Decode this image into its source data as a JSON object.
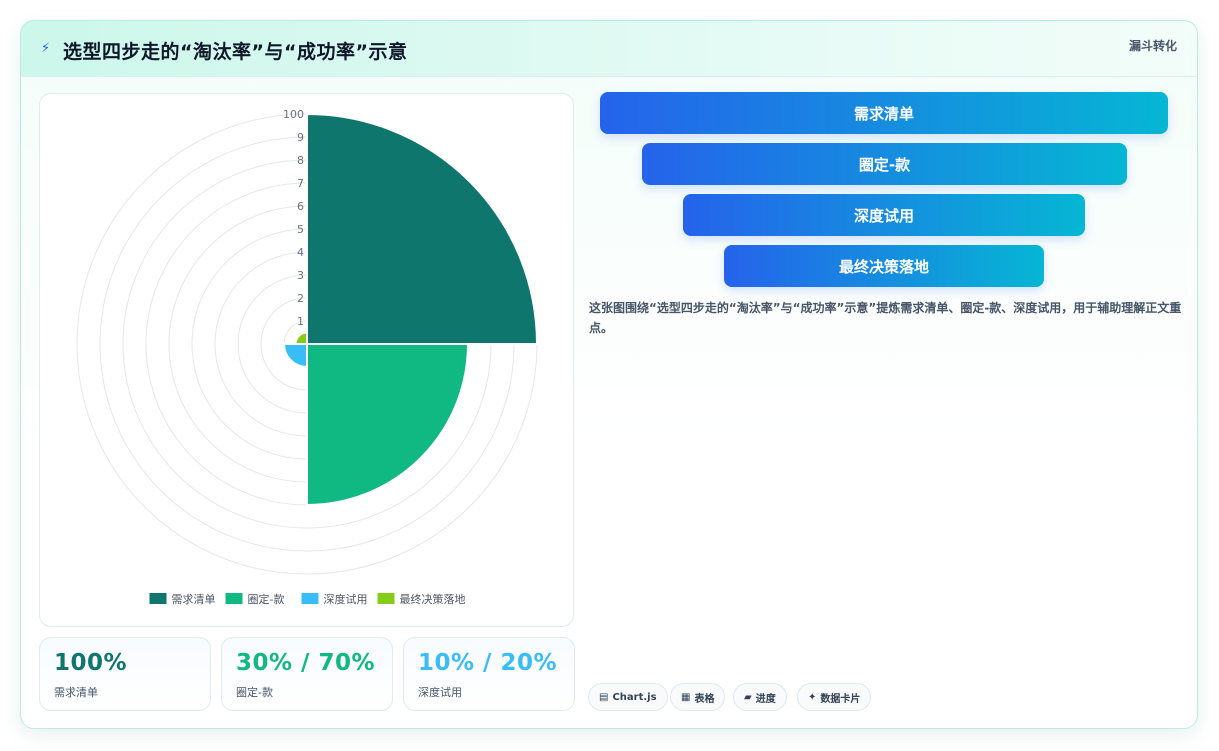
{
  "header": {
    "icon": "lightning-icon",
    "title": "选型四步走的“淘汰率”与“成功率”示意",
    "tag": "漏斗转化"
  },
  "chart_data": {
    "type": "polarArea",
    "categories": [
      "需求清单",
      "圈定-款",
      "深度试用",
      "最终决策落地"
    ],
    "values": [
      100,
      70,
      10,
      5
    ],
    "colors": [
      "#0f766e",
      "#10b981",
      "#38bdf8",
      "#84cc16"
    ],
    "radial_range": [
      0,
      100
    ],
    "tick_labels": [
      "100",
      "9",
      "8",
      "7",
      "6",
      "5",
      "4",
      "3",
      "2",
      "1"
    ],
    "legend_position": "bottom",
    "grid": true
  },
  "stats": [
    {
      "value": "100%",
      "label": "需求清单",
      "color": "#0f766e"
    },
    {
      "value": "30% / 70%",
      "label": "圈定-款",
      "color": "#10b981"
    },
    {
      "value": "10% / 20%",
      "label": "深度试用",
      "color": "#38bdf8"
    }
  ],
  "funnel": [
    {
      "label": "需求清单"
    },
    {
      "label": "圈定-款"
    },
    {
      "label": "深度试用"
    },
    {
      "label": "最终决策落地"
    }
  ],
  "description": "这张图围绕“选型四步走的“淘汰率”与“成功率”示意”提炼需求清单、圈定-款、深度试用，用于辅助理解正文重点。",
  "pills": [
    {
      "icon": "chart-icon",
      "glyph": "▤",
      "label": "Chart.js"
    },
    {
      "icon": "table-icon",
      "glyph": "▦",
      "label": "表格"
    },
    {
      "icon": "progress-icon",
      "glyph": "▰",
      "label": "进度"
    },
    {
      "icon": "sparkle-icon",
      "glyph": "✦",
      "label": "数据卡片"
    }
  ]
}
